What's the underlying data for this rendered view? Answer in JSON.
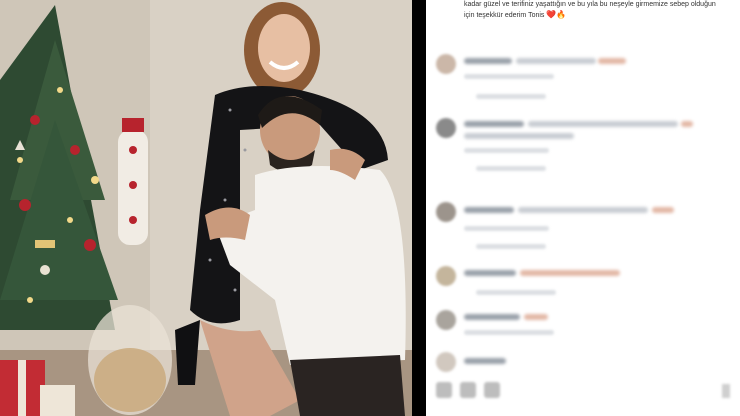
{
  "post": {
    "caption": "kadar güzel ve terifiniz yaşattığın ve bu yıla bu neşeyle girmemize sebep olduğun için teşekkür ederim Tonis",
    "caption_emoji": "❤️🔥"
  },
  "colors": {
    "background": "#ffffff",
    "divider": "#000000",
    "heart": "#c0282d"
  },
  "icons": {
    "like": "heart-icon",
    "comment": "comment-icon",
    "share": "share-icon",
    "save": "bookmark-icon"
  }
}
